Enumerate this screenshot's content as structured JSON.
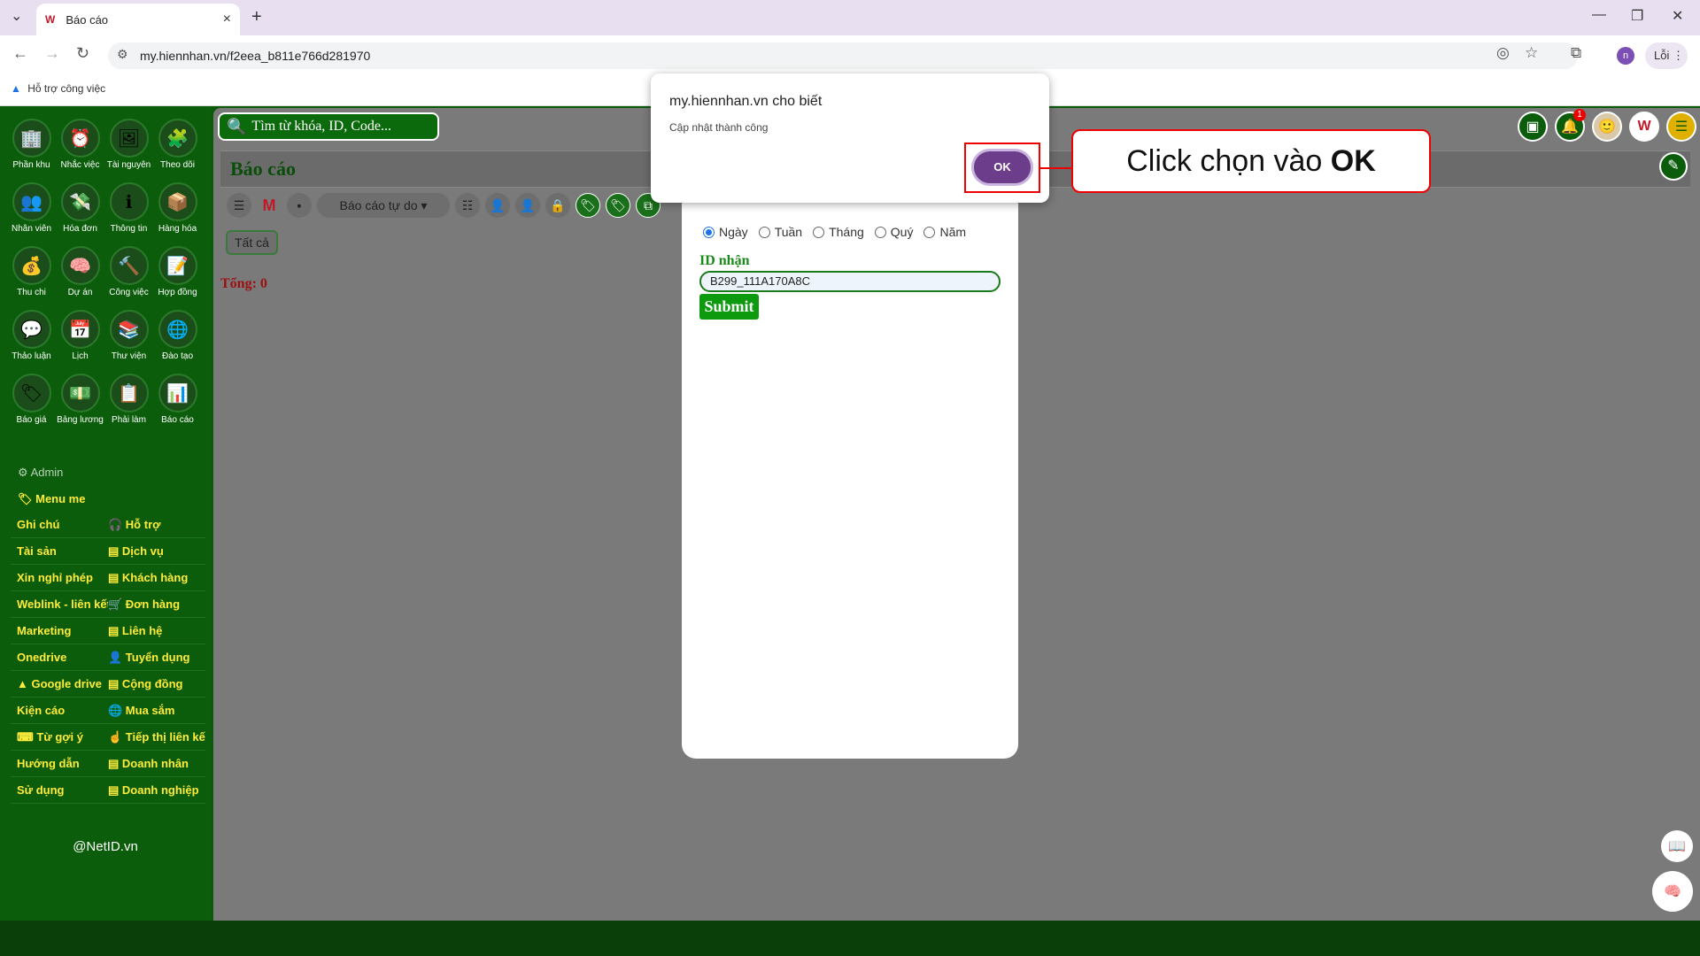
{
  "browser": {
    "tab_title": "Báo cáo",
    "url": "my.hiennhan.vn/f2eea_b811e766d281970",
    "profile_initial": "n",
    "error_label": "Lỗi",
    "bookmark": "Hỗ trợ công việc"
  },
  "search": {
    "placeholder": "Tìm từ khóa, ID, Code..."
  },
  "notifications": {
    "count": "1"
  },
  "apps": [
    {
      "label": "Phần khu",
      "icon": "🏢"
    },
    {
      "label": "Nhắc việc",
      "icon": "⏰"
    },
    {
      "label": "Tài nguyên",
      "icon": "🖼"
    },
    {
      "label": "Theo dõi",
      "icon": "🧩"
    },
    {
      "label": "Nhân viên",
      "icon": "👥"
    },
    {
      "label": "Hóa đơn",
      "icon": "💸"
    },
    {
      "label": "Thông tin",
      "icon": "ℹ"
    },
    {
      "label": "Hàng hóa",
      "icon": "📦"
    },
    {
      "label": "Thu chi",
      "icon": "💰"
    },
    {
      "label": "Dự án",
      "icon": "🧠"
    },
    {
      "label": "Công việc",
      "icon": "🔨"
    },
    {
      "label": "Hợp đồng",
      "icon": "📝"
    },
    {
      "label": "Thảo luận",
      "icon": "💬"
    },
    {
      "label": "Lịch",
      "icon": "📅"
    },
    {
      "label": "Thư viện",
      "icon": "📚"
    },
    {
      "label": "Đào tạo",
      "icon": "🌐"
    },
    {
      "label": "Báo giá",
      "icon": "🏷"
    },
    {
      "label": "Bảng lương",
      "icon": "💵"
    },
    {
      "label": "Phải làm",
      "icon": "📋"
    },
    {
      "label": "Báo cáo",
      "icon": "📊"
    }
  ],
  "sidebar": {
    "admin": "Admin",
    "menu_me": "Menu me",
    "rows": [
      [
        "Ghi chú",
        "🎧 Hỗ trợ"
      ],
      [
        "Tài sản",
        "▤ Dịch vụ"
      ],
      [
        "Xin nghỉ phép",
        "▤ Khách hàng"
      ],
      [
        "Weblink - liên kết",
        "🛒 Đơn hàng"
      ],
      [
        "Marketing",
        "▤ Liên hệ"
      ],
      [
        "Onedrive",
        "👤 Tuyển dụng"
      ],
      [
        "▲ Google drive",
        "▤ Cộng đồng"
      ],
      [
        "Kiện cáo",
        "🌐 Mua sắm"
      ],
      [
        "⌨ Từ gợi ý",
        "☝ Tiếp thị liên kết"
      ],
      [
        "Hướng dẫn",
        "▤ Doanh nhân"
      ],
      [
        "Sử dụng",
        "▤ Doanh nghiệp"
      ]
    ],
    "footer": "@NetID.vn"
  },
  "page": {
    "title": "Báo cáo",
    "report_dropdown": "Báo cáo tự do ▾",
    "filter_all": "Tất cả",
    "total": "Tổng: 0"
  },
  "form": {
    "periods": [
      "Ngày",
      "Tuần",
      "Tháng",
      "Quý",
      "Năm"
    ],
    "selected_period": "Ngày",
    "id_label": "ID nhận",
    "id_value": "B299_111A170A8C",
    "submit_label": "Submit"
  },
  "alert": {
    "title": "my.hiennhan.vn cho biết",
    "message": "Cập nhật thành công",
    "ok_label": "OK"
  },
  "callout": {
    "text": "Click chọn vào ",
    "bold": "OK"
  }
}
